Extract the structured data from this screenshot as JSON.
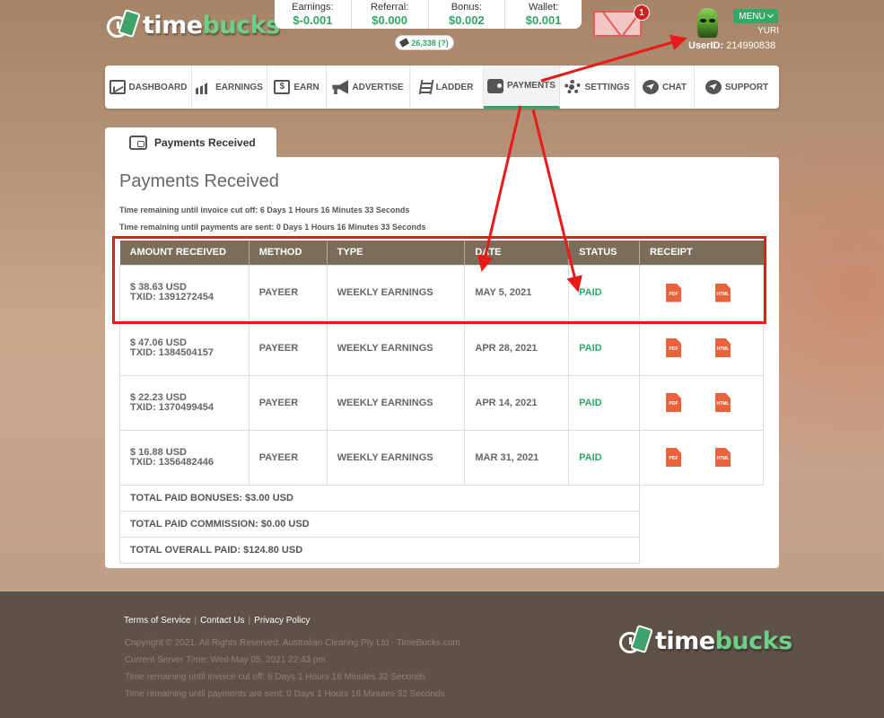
{
  "brand": {
    "name_part1": "time",
    "name_part2": "bucks"
  },
  "stats": [
    {
      "label": "Earnings:",
      "value": "$-0.001"
    },
    {
      "label": "Referral:",
      "value": "$0.000"
    },
    {
      "label": "Bonus:",
      "value": "$0.002"
    },
    {
      "label": "Wallet:",
      "value": "$0.001"
    }
  ],
  "coins": "26,338 (?)",
  "mail_badge": "1",
  "user": {
    "menu_label": "MENU",
    "name": "YURI",
    "userid_label": "UserID:",
    "userid": "214990838"
  },
  "nav": [
    {
      "label": "DASHBOARD",
      "icon": "dashboard-icon"
    },
    {
      "label": "EARNINGS",
      "icon": "earnings-chart-icon"
    },
    {
      "label": "EARN",
      "icon": "dollar-icon"
    },
    {
      "label": "ADVERTISE",
      "icon": "megaphone-icon"
    },
    {
      "label": "LADDER",
      "icon": "ladder-icon"
    },
    {
      "label": "PAYMENTS",
      "icon": "wallet-icon",
      "active": true
    },
    {
      "label": "SETTINGS",
      "icon": "gear-icon"
    },
    {
      "label": "CHAT",
      "icon": "chat-icon"
    },
    {
      "label": "SUPPORT",
      "icon": "paper-plane-icon"
    }
  ],
  "tab_label": "Payments Received",
  "page_title": "Payments Received",
  "timers": {
    "invoice": "Time remaining until invoice cut off: 6 Days 1 Hours 16 Minutes 33 Seconds",
    "payments": "Time remaining until payments are sent: 0 Days 1 Hours 16 Minutes 33 Seconds"
  },
  "table": {
    "headers": [
      "AMOUNT RECEIVED",
      "METHOD",
      "TYPE",
      "DATE",
      "STATUS",
      "RECEIPT"
    ],
    "rows": [
      {
        "amount": "$ 38.63 USD",
        "txid": "TXID: 1391272454",
        "method": "PAYEER",
        "type": "WEEKLY EARNINGS",
        "date": "MAY 5, 2021",
        "status": "PAID"
      },
      {
        "amount": "$ 47.06 USD",
        "txid": "TXID: 1384504157",
        "method": "PAYEER",
        "type": "WEEKLY EARNINGS",
        "date": "APR 28, 2021",
        "status": "PAID"
      },
      {
        "amount": "$ 22.23 USD",
        "txid": "TXID: 1370499454",
        "method": "PAYEER",
        "type": "WEEKLY EARNINGS",
        "date": "APR 14, 2021",
        "status": "PAID"
      },
      {
        "amount": "$ 16.88 USD",
        "txid": "TXID: 1356482446",
        "method": "PAYEER",
        "type": "WEEKLY EARNINGS",
        "date": "MAR 31, 2021",
        "status": "PAID"
      }
    ],
    "receipt_pdf": "PDF",
    "receipt_html": "HTML",
    "totals": [
      "TOTAL PAID BONUSES: $3.00 USD",
      "TOTAL PAID COMMISSION: $0.00 USD",
      "TOTAL OVERALL PAID: $124.80 USD"
    ]
  },
  "footer": {
    "links": [
      "Terms of Service",
      "Contact Us",
      "Privacy Policy"
    ],
    "copyright": "Copyright © 2021. All Rights Reserved. Australian Clearing Pty Ltd - TimeBucks.com",
    "server_time": "Current Server Time: Wed May 05, 2021 22:43 pm",
    "invoice_timer": "Time remaining until invoice cut off: 6 Days 1 Hours 16 Minutes 32 Seconds",
    "payments_timer": "Time remaining until payments are sent: 0 Days 1 Hours 16 Minutes 32 Seconds"
  },
  "colors": {
    "accent_green": "#2ea862",
    "table_header": "#7a6d5a",
    "annotation_red": "#e81a1a",
    "footer_bg": "#5e5147"
  }
}
